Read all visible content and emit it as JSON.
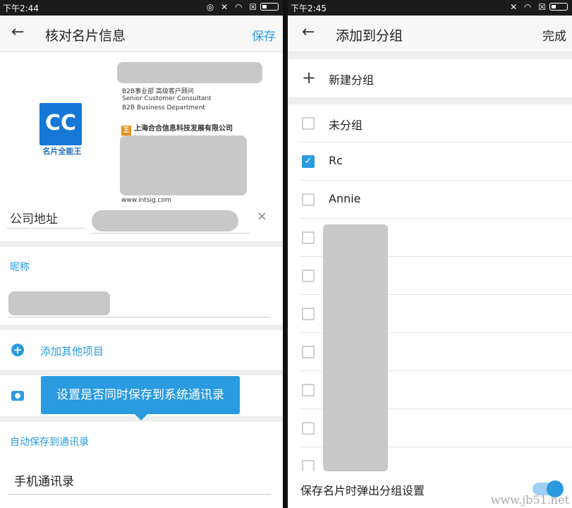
{
  "left": {
    "status_time": "下午2:44",
    "title": "核对名片信息",
    "save_label": "保存",
    "logo_text": "CC",
    "logo_caption": "名片全能王",
    "card_lines": [
      "B2B事业部  高级客户顾问",
      "Senior Customer Consultant",
      "B2B Business Department"
    ],
    "company_mark": "王",
    "company_name": "上海合合信息科技发展有限公司",
    "website": "www.intsig.com",
    "address_label": "公司地址",
    "clear_icon": "×",
    "nickname_label": "昵称",
    "add_other_label": "添加其他项目",
    "tooltip_text": "设置是否同时保存到系统通讯录",
    "autosave_label": "自动保存到通讯录",
    "contacts_value": "手机通讯录",
    "accent_color": "#2a9be0"
  },
  "right": {
    "status_time": "下午2:45",
    "title": "添加到分组",
    "done_label": "完成",
    "new_group_label": "新建分组",
    "groups": [
      {
        "label": "未分组",
        "checked": false
      },
      {
        "label": "Rc",
        "checked": true
      },
      {
        "label": "Annie",
        "checked": false
      }
    ],
    "footer_label": "保存名片时弹出分组设置",
    "toggle_on": true,
    "watermark": "www.jb51.net"
  }
}
